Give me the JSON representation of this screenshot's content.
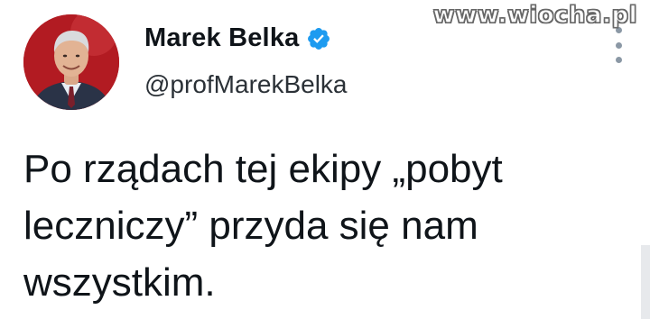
{
  "profile": {
    "display_name": "Marek Belka",
    "handle": "@profMarekBelka",
    "verified": true,
    "avatar": "avatar-portrait",
    "verified_icon": "verified-badge-icon",
    "verified_color": "#1d9bf0"
  },
  "tweet": {
    "lines": [
      "Po rządach tej ekipy „pobyt",
      "leczniczy” przyda się nam",
      "wszystkim."
    ]
  },
  "watermark": {
    "text": "www.wiocha.pl"
  },
  "icons": {
    "more": "more-options-icon"
  },
  "colors": {
    "text": "#0f1419",
    "handle": "#2b3137",
    "avatar_background": "#b21b22",
    "background": "#ffffff"
  }
}
